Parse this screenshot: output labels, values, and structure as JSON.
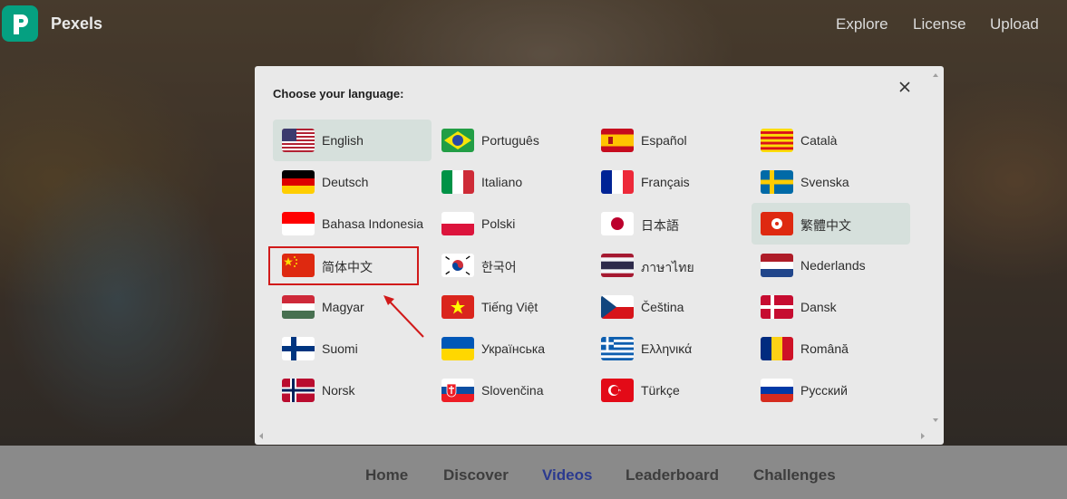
{
  "topbar": {
    "brand": "Pexels",
    "links": [
      "Explore",
      "License",
      "Upload"
    ]
  },
  "bottom_tabs": [
    {
      "label": "Home",
      "active": false
    },
    {
      "label": "Discover",
      "active": false
    },
    {
      "label": "Videos",
      "active": true
    },
    {
      "label": "Leaderboard",
      "active": false
    },
    {
      "label": "Challenges",
      "active": false
    }
  ],
  "modal": {
    "title": "Choose your language:",
    "close_icon": "close-icon",
    "languages": [
      {
        "label": "English",
        "flag": "us",
        "selected": true
      },
      {
        "label": "Português",
        "flag": "br",
        "selected": false
      },
      {
        "label": "Español",
        "flag": "es",
        "selected": false
      },
      {
        "label": "Català",
        "flag": "cat",
        "selected": false
      },
      {
        "label": "Deutsch",
        "flag": "de",
        "selected": false
      },
      {
        "label": "Italiano",
        "flag": "it",
        "selected": false
      },
      {
        "label": "Français",
        "flag": "fr",
        "selected": false
      },
      {
        "label": "Svenska",
        "flag": "se",
        "selected": false
      },
      {
        "label": "Bahasa Indonesia",
        "flag": "id",
        "selected": false
      },
      {
        "label": "Polski",
        "flag": "pl",
        "selected": false
      },
      {
        "label": "日本語",
        "flag": "jp",
        "selected": false
      },
      {
        "label": "繁體中文",
        "flag": "hk",
        "selected": true
      },
      {
        "label": "简体中文",
        "flag": "cn",
        "selected": false
      },
      {
        "label": "한국어",
        "flag": "kr",
        "selected": false
      },
      {
        "label": "ภาษาไทย",
        "flag": "th",
        "selected": false
      },
      {
        "label": "Nederlands",
        "flag": "nl",
        "selected": false
      },
      {
        "label": "Magyar",
        "flag": "hu",
        "selected": false
      },
      {
        "label": "Tiếng Việt",
        "flag": "vn",
        "selected": false
      },
      {
        "label": "Čeština",
        "flag": "cz",
        "selected": false
      },
      {
        "label": "Dansk",
        "flag": "dk",
        "selected": false
      },
      {
        "label": "Suomi",
        "flag": "fi",
        "selected": false
      },
      {
        "label": "Українська",
        "flag": "ua",
        "selected": false
      },
      {
        "label": "Ελληνικά",
        "flag": "gr",
        "selected": false
      },
      {
        "label": "Română",
        "flag": "ro",
        "selected": false
      },
      {
        "label": "Norsk",
        "flag": "no",
        "selected": false
      },
      {
        "label": "Slovenčina",
        "flag": "sk",
        "selected": false
      },
      {
        "label": "Türkçe",
        "flag": "tr",
        "selected": false
      },
      {
        "label": "Русский",
        "flag": "ru",
        "selected": false
      }
    ]
  },
  "colors": {
    "brand": "#05a081",
    "active_tab": "#2b3a8f",
    "annotation": "#d11a1a",
    "selected_bg": "#d6e0dc"
  }
}
